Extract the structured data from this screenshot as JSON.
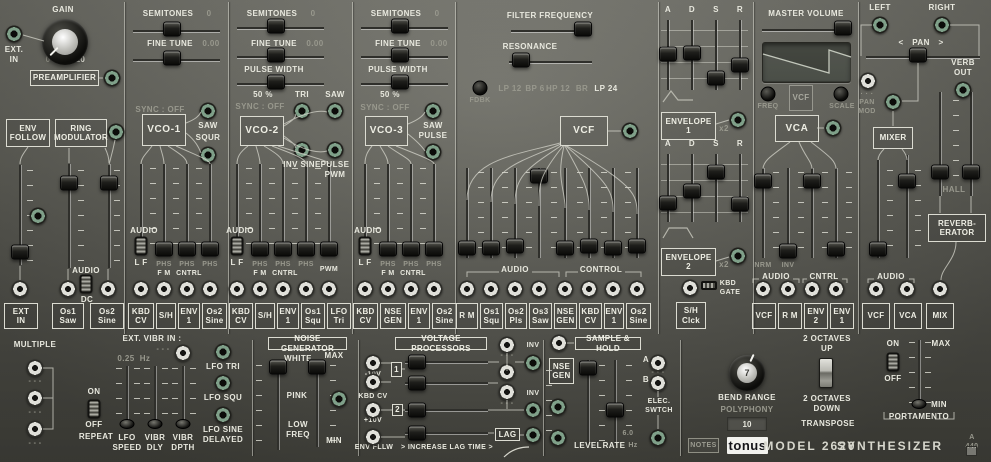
{
  "panel": {
    "brand": "tonus",
    "model": "MODEL  2620",
    "type": "SYNTHESIZER",
    "tuning": "A 440",
    "notes_btn": "NOTES"
  },
  "preamp": {
    "gain": "GAIN",
    "ext_in": "EXT.\nIN",
    "min": "0",
    "max": "x10",
    "title": "PREAMPLIFIER",
    "env_follow": "ENV\nFOLLOW",
    "ring_mod": "RING\nMODULATOR",
    "audio": "AUDIO",
    "dc": "DC",
    "jacks": [
      "EXT\nIN",
      "Os1\nSaw",
      "Os2\nSine"
    ]
  },
  "vco_common": {
    "semitones": "SEMITONES",
    "semitones_value": "0",
    "fine_tune": "FINE TUNE",
    "fine_tune_value": "0.00",
    "pulse_width": "PULSE  WIDTH",
    "pulse_width_value": "50 %",
    "sync": "SYNC : OFF",
    "audio": "AUDIO",
    "lf": "L F",
    "phs": "PHS",
    "fm": "F M",
    "cntrl": "CNTRL",
    "pwm": "PWM"
  },
  "vco1": {
    "title": "VCO-1",
    "out1": "SAW",
    "out2": "SQUR",
    "jacks": [
      "KBD\nCV",
      "S/H",
      "ENV\n1",
      "Os2\nSine"
    ]
  },
  "vco2": {
    "title": "VCO-2",
    "out1": "TRI",
    "out2": "SAW",
    "out3": "INV SINE",
    "out4": "PULSE\nPWM",
    "jacks": [
      "KBD\nCV",
      "S/H",
      "ENV\n1",
      "Os1\nSqu",
      "LFO\nTri"
    ]
  },
  "vco3": {
    "title": "VCO-3",
    "out1": "SAW",
    "out2": "PULSE",
    "jacks": [
      "KBD\nCV",
      "NSE\nGEN",
      "ENV\n1",
      "Os2\nSine"
    ]
  },
  "vcf": {
    "freq_label": "FILTER  FREQUENCY",
    "res_label": "RESONANCE",
    "fdbk": "FDBK",
    "modes": [
      "LP 12",
      "BP 6",
      "HP 12",
      "BR",
      "LP 24"
    ],
    "title": "VCF",
    "audio": "AUDIO",
    "control": "CONTROL",
    "jacks": [
      "R M",
      "Os1\nSqu",
      "Os2\nPls",
      "Os3\nSaw",
      "NSE\nGEN",
      "KBD\nCV",
      "ENV\n1",
      "Os2\nSine"
    ]
  },
  "env": {
    "adsr": [
      "A",
      "D",
      "S",
      "R"
    ],
    "env1_title": "ENVELOPE\n1",
    "env2_title": "ENVELOPE\n2",
    "x2": "x2",
    "kbd_gate": "KBD\nGATE",
    "sh_clock": "S/H\nClck"
  },
  "vca": {
    "master": "MASTER VOLUME",
    "freq": "FREQ",
    "vcf_disp": "VCF",
    "scale": "SCALE",
    "title": "VCA",
    "nrm": "NRM",
    "inv": "INV",
    "audio": "AUDIO",
    "cntrl": "CNTRL",
    "jacks": [
      "VCF",
      "R M",
      "ENV\n2",
      "ENV\n1"
    ]
  },
  "out": {
    "left": "LEFT",
    "right": "RIGHT",
    "pan_left": "<",
    "pan": "PAN",
    "pan_right": ">",
    "dots": "· · ·",
    "pan_mod": "PAN\nMOD",
    "verb_out": "VERB\nOUT",
    "mixer": "MIXER",
    "hall": "HALL",
    "reverb": "REVERB-\nERATOR",
    "audio": "AUDIO",
    "jacks": [
      "VCF",
      "VCA",
      "MIX"
    ]
  },
  "lfo": {
    "multiple": "MULTIPLE",
    "dash": "- - -",
    "on": "ON",
    "off": "OFF",
    "repeat": "REPEAT",
    "ext_vibr": "EXT. VIBR IN :",
    "rate_value": "0.25",
    "hz": "Hz",
    "sliders": [
      "LFO\nSPEED",
      "VIBR\nDLY",
      "VIBR\nDPTH"
    ],
    "outs": [
      "LFO TRI",
      "LFO SQU",
      "LFO SINE\nDELAYED"
    ]
  },
  "noise": {
    "title": "NOISE GENERATOR",
    "white": "WHITE",
    "pink": "PINK",
    "lowfreq": "LOW\nFREQ",
    "max": "MAX",
    "min": "MIN"
  },
  "vp": {
    "title": "VOLTAGE PROCESSORS",
    "in1": "-10V",
    "in2": "KBD CV",
    "in3": "+10V",
    "in4": "ENV FLLW",
    "group1": "1",
    "group2": "2",
    "inv": "INV",
    "dash": "- - -",
    "lag": "LAG",
    "lag_note": ">  INCREASE LAG TIME  >"
  },
  "sh": {
    "title": "SAMPLE & HOLD",
    "nse_gen": "NSE\nGEN",
    "level": "LEVEL",
    "rate": "RATE",
    "rate_value": "6.0",
    "hz": "Hz",
    "a": "A",
    "b": "B",
    "dash": "- - -",
    "elec_switch": "ELEC.\nSWTCH"
  },
  "perf": {
    "bend_range": "BEND  RANGE",
    "bend_value": "7",
    "polyphony": "POLYPHONY",
    "polyphony_value": "10",
    "oct_up": "2 OCTAVES\nUP",
    "oct_down": "2 OCTAVES\nDOWN",
    "transpose": "TRANSPOSE",
    "on": "ON",
    "off": "OFF",
    "max": "MAX",
    "min": "MIN",
    "portamento": "PORTAMENTO"
  },
  "colors": {
    "jack_ring": "#7fa089",
    "panel_top": "#74746c",
    "panel_bottom": "#474740",
    "label": "#e8e8de"
  }
}
